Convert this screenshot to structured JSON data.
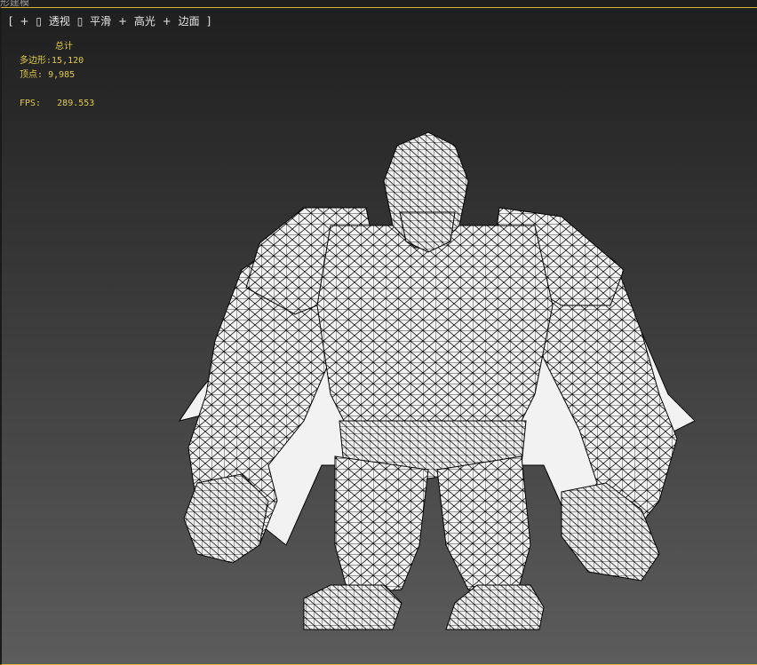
{
  "window": {
    "title": "形建模"
  },
  "viewport": {
    "menu": [
      "[",
      "+",
      "▯",
      "透视",
      "▯",
      "平滑",
      "+",
      "高光",
      "+",
      "边面",
      "]"
    ],
    "stats": {
      "header": "总计",
      "polygons_label": "多边形:",
      "polygons_value": "15,120",
      "vertices_label": "顶点:",
      "vertices_value": "9,985",
      "fps_label": "FPS:",
      "fps_value": "289.553"
    }
  },
  "colors": {
    "stats_text": "#e0c94a",
    "viewport_border": "#d6b43a",
    "mesh_fill": "#f2f2f2",
    "mesh_line": "#000000"
  }
}
